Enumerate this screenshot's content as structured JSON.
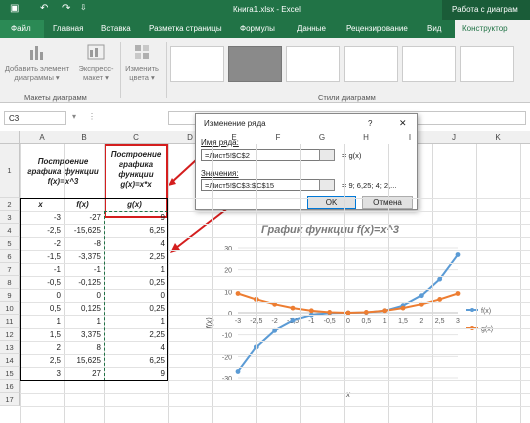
{
  "titlebar": {
    "title": "Книга1.xlsx - Excel",
    "tools_label": "Работа с диаграм"
  },
  "tabs": {
    "file": "Файл",
    "home": "Главная",
    "insert": "Вставка",
    "layout": "Разметка страницы",
    "formulas": "Формулы",
    "data": "Данные",
    "review": "Рецензирование",
    "view": "Вид",
    "design": "Конструктор"
  },
  "ribbon": {
    "add_element": "Добавить элемент диаграммы ▾",
    "express": "Экспресс-макет ▾",
    "change_colors": "Изменить цвета ▾",
    "group_layouts": "Макеты диаграмм",
    "group_styles": "Стили диаграмм"
  },
  "namebox": "C3",
  "columns": [
    "A",
    "B",
    "C",
    "D",
    "E",
    "F",
    "G",
    "H",
    "I",
    "J",
    "K",
    "L"
  ],
  "rows": [
    "1",
    "2",
    "3",
    "4",
    "5",
    "6",
    "7",
    "8",
    "9",
    "10",
    "11",
    "12",
    "13",
    "14",
    "15",
    "16",
    "17"
  ],
  "sheet": {
    "hdr_b": "Построение графика функции f(x)=x^3",
    "hdr_c": "Построение графика функции g(x)=x*x",
    "col_x": "x",
    "col_fx": "f(x)",
    "col_gx": "g(x)",
    "x": [
      "-3",
      "-2,5",
      "-2",
      "-1,5",
      "-1",
      "-0,5",
      "0",
      "0,5",
      "1",
      "1,5",
      "2",
      "2,5",
      "3"
    ],
    "fx": [
      "-27",
      "-15,625",
      "-8",
      "-3,375",
      "-1",
      "-0,125",
      "0",
      "0,125",
      "1",
      "3,375",
      "8",
      "15,625",
      "27"
    ],
    "gx": [
      "9",
      "6,25",
      "4",
      "2,25",
      "1",
      "0,25",
      "0",
      "0,25",
      "1",
      "2,25",
      "4",
      "6,25",
      "9"
    ]
  },
  "dialog": {
    "title": "Изменение ряда",
    "help": "?",
    "close": "✕",
    "name_label": "Имя ряда:",
    "name_value": "=Лист5!$C$2",
    "name_preview": "= g(x)",
    "values_label": "Значения:",
    "values_value": "=Лист5!$C$3:$C$15",
    "values_preview": "= 9; 6,25; 4; 2,...",
    "ok": "OK",
    "cancel": "Отмена"
  },
  "colors": {
    "excel_green": "#217346",
    "series_f": "#5b9bd5",
    "series_g": "#ed7d31",
    "arrow_red": "#d41e1e"
  },
  "chart_data": {
    "type": "line",
    "title": "График функции f(x)=x^3",
    "xlabel": "x",
    "ylabel": "f(x)",
    "categories": [
      "-3",
      "-2,5",
      "-2",
      "-1,5",
      "-1",
      "-0,5",
      "0",
      "0,5",
      "1",
      "1,5",
      "2",
      "2,5",
      "3"
    ],
    "ylim": [
      -30,
      30
    ],
    "yticks": [
      "30",
      "20",
      "10",
      "0",
      "-10",
      "-20",
      "-30"
    ],
    "series": [
      {
        "name": "f(x)",
        "values": [
          -27,
          -15.625,
          -8,
          -3.375,
          -1,
          -0.125,
          0,
          0.125,
          1,
          3.375,
          8,
          15.625,
          27
        ]
      },
      {
        "name": "g(x)",
        "values": [
          9,
          6.25,
          4,
          2.25,
          1,
          0.25,
          0,
          0.25,
          1,
          2.25,
          4,
          6.25,
          9
        ]
      }
    ],
    "legend": "right",
    "grid": true
  }
}
